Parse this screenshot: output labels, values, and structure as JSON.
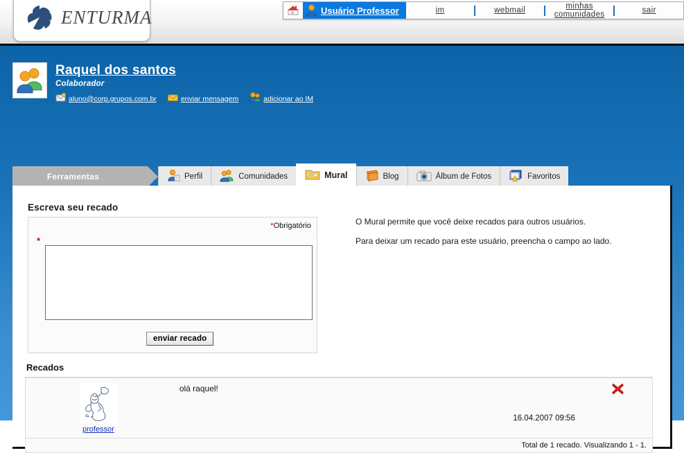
{
  "header": {
    "brand": "ENTURMA",
    "home_icon": "home-icon",
    "user_icon": "user-avatar-icon",
    "user_label": "Usuário Professor",
    "links": [
      {
        "label": "im",
        "name": "im"
      },
      {
        "label": "webmail",
        "name": "webmail"
      },
      {
        "label": "minhas comunidades",
        "name": "minhas-comunidades"
      },
      {
        "label": "sair",
        "name": "sair"
      }
    ]
  },
  "profile": {
    "avatar_icon": "users-group-icon",
    "name": "Raquel dos santos",
    "role": "Colaborador",
    "links": [
      {
        "label": "aluno@corp.grupos.com.br",
        "icon": "mail-icon",
        "name": "email"
      },
      {
        "label": "enviar mensagem",
        "icon": "envelope-send-icon",
        "name": "enviar-mensagem"
      },
      {
        "label": "adicionar ao IM",
        "icon": "add-contact-icon",
        "name": "adicionar-ao-im"
      }
    ]
  },
  "tabs": {
    "tools_label": "Ferramentas",
    "items": [
      {
        "label": "Perfil",
        "icon": "profile-person-icon",
        "active": false
      },
      {
        "label": "Comunidades",
        "icon": "community-people-icon",
        "active": false
      },
      {
        "label": "Mural",
        "icon": "folder-board-icon",
        "active": true
      },
      {
        "label": "Blog",
        "icon": "book-icon",
        "active": false
      },
      {
        "label": "Álbum de Fotos",
        "icon": "camera-icon",
        "active": false
      },
      {
        "label": "Favoritos",
        "icon": "favorites-star-icon",
        "active": false
      }
    ]
  },
  "form": {
    "title": "Escreva seu recado",
    "required_note": "Obrigatório",
    "required_marker": "*",
    "textarea_value": "",
    "textarea_placeholder": "",
    "submit_label": "enviar recado"
  },
  "help": {
    "line1": "O Mural permite que você deixe recados para outros usuários.",
    "line2": "Para deixar um recado para este usuário, preencha o campo ao lado."
  },
  "recados": {
    "title": "Recados",
    "items": [
      {
        "author": "professor",
        "avatar_icon": "sketch-person-avatar",
        "message": "olá raquel!",
        "date": "16.04.2007 09:56",
        "delete_icon": "red-x-delete-icon"
      }
    ],
    "footer": "Total de 1 recado. Visualizando 1 - 1."
  },
  "colors": {
    "blue_top": "#0c63a8",
    "blue_bottom": "#4298d8",
    "accent_chip": "#0a7ae0",
    "tab_gray": "#b3b3b3",
    "required_red": "#cc0000",
    "link_blue": "#1430bb"
  }
}
